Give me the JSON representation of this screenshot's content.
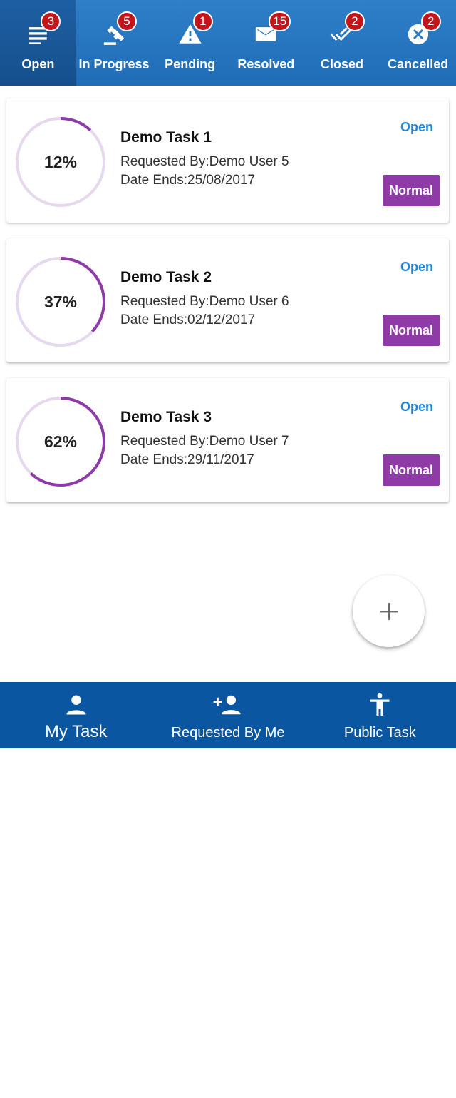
{
  "status_tabs": [
    {
      "label": "Open",
      "count": "3",
      "icon": "list-icon"
    },
    {
      "label": "In Progress",
      "count": "5",
      "icon": "gavel-icon"
    },
    {
      "label": "Pending",
      "count": "1",
      "icon": "warning-icon"
    },
    {
      "label": "Resolved",
      "count": "15",
      "icon": "mail-icon"
    },
    {
      "label": "Closed",
      "count": "2",
      "icon": "double-check-icon"
    },
    {
      "label": "Cancelled",
      "count": "2",
      "icon": "cancel-circle-icon"
    }
  ],
  "tasks": [
    {
      "title": "Demo Task 1",
      "requested_by": "Requested By:Demo User 5",
      "date_ends": "Date Ends:25/08/2017",
      "status": "Open",
      "priority": "Normal",
      "progress_label": "12%",
      "progress": 12
    },
    {
      "title": "Demo Task 2",
      "requested_by": "Requested By:Demo User 6",
      "date_ends": "Date Ends:02/12/2017",
      "status": "Open",
      "priority": "Normal",
      "progress_label": "37%",
      "progress": 37
    },
    {
      "title": "Demo Task 3",
      "requested_by": "Requested By:Demo User 7",
      "date_ends": "Date Ends:29/11/2017",
      "status": "Open",
      "priority": "Normal",
      "progress_label": "62%",
      "progress": 62
    }
  ],
  "fab": {
    "icon": "plus-icon"
  },
  "bottom_nav": [
    {
      "label": "My Task",
      "icon": "person-icon"
    },
    {
      "label": "Requested By Me",
      "icon": "person-add-icon"
    },
    {
      "label": "Public Task",
      "icon": "accessibility-icon"
    }
  ],
  "colors": {
    "topbar": "#1f6cb7",
    "badge": "#c0161c",
    "status_text": "#1f86d9",
    "priority": "#8e3aa7",
    "progress_arc": "#8e3aa7",
    "progress_track": "#e6d8ee",
    "bottom_nav": "#0a56a0"
  }
}
